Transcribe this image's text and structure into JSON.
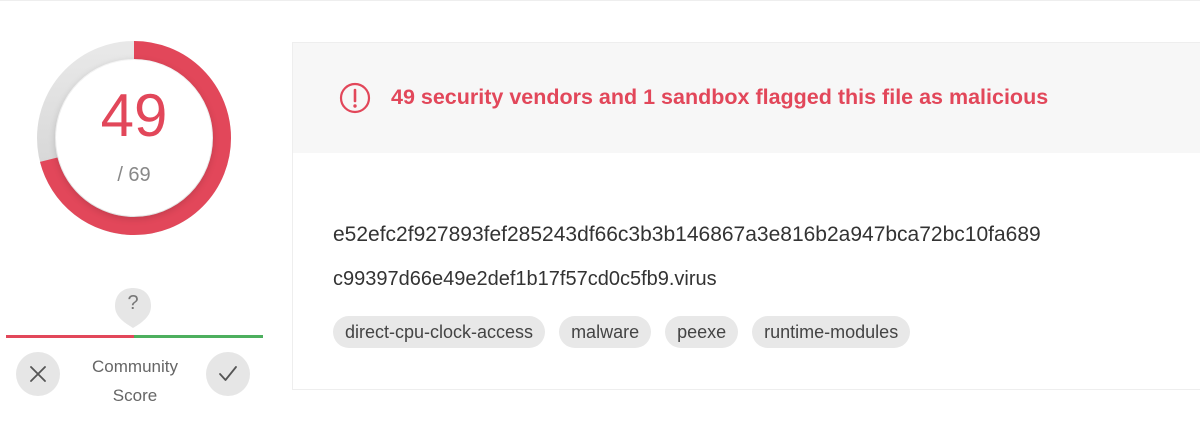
{
  "score": {
    "detections": "49",
    "total": "/ 69",
    "fraction_detected": 0.71,
    "color": "#e2475a"
  },
  "community": {
    "marker_text": "?",
    "label_line1": "Community",
    "label_line2": "Score",
    "down_icon": "x-icon",
    "up_icon": "check-icon",
    "negative_color": "#e2475a",
    "positive_color": "#4daf5e"
  },
  "alert": {
    "icon": "alert-circle-icon",
    "text": "49 security vendors and 1 sandbox flagged this file as malicious",
    "color": "#e2475a"
  },
  "file": {
    "hash": "e52efc2f927893fef285243df66c3b3b146867a3e816b2a947bca72bc10fa689",
    "name": "c99397d66e49e2def1b17f57cd0c5fb9.virus"
  },
  "tags": [
    "direct-cpu-clock-access",
    "malware",
    "peexe",
    "runtime-modules"
  ]
}
